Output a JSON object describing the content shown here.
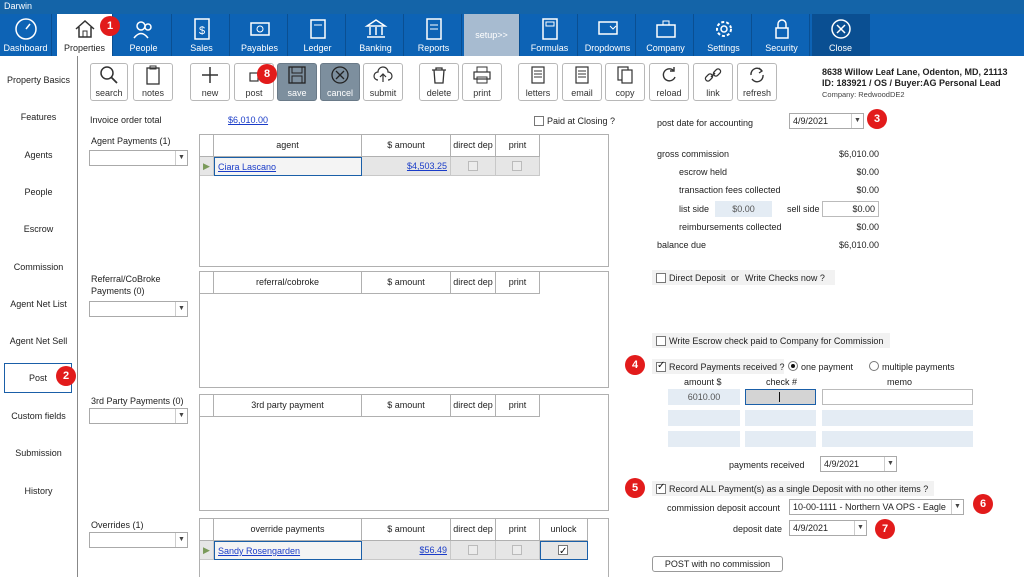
{
  "window": {
    "title": "Darwin"
  },
  "nav": {
    "items": [
      {
        "label": "Dashboard",
        "icon": "dashboard-icon"
      },
      {
        "label": "Properties",
        "icon": "house-icon"
      },
      {
        "label": "People",
        "icon": "people-icon"
      },
      {
        "label": "Sales",
        "icon": "dollar-doc-icon"
      },
      {
        "label": "Payables",
        "icon": "money-icon"
      },
      {
        "label": "Ledger",
        "icon": "ledger-icon"
      },
      {
        "label": "Banking",
        "icon": "bank-icon"
      },
      {
        "label": "Reports",
        "icon": "report-icon"
      },
      {
        "label": "setup>>",
        "icon": ""
      },
      {
        "label": "Formulas",
        "icon": "calculator-icon"
      },
      {
        "label": "Dropdowns",
        "icon": "dropdown-icon"
      },
      {
        "label": "Company",
        "icon": "briefcase-icon"
      },
      {
        "label": "Settings",
        "icon": "gear-icon"
      },
      {
        "label": "Security",
        "icon": "lock-icon"
      },
      {
        "label": "Close",
        "icon": "close-icon"
      }
    ]
  },
  "badges": [
    "1",
    "2",
    "3",
    "4",
    "5",
    "6",
    "7",
    "8"
  ],
  "sidebar": {
    "items": [
      {
        "label": "Property Basics"
      },
      {
        "label": "Features"
      },
      {
        "label": "Agents"
      },
      {
        "label": "People"
      },
      {
        "label": "Escrow"
      },
      {
        "label": "Commission"
      },
      {
        "label": "Agent Net List"
      },
      {
        "label": "Agent Net Sell"
      },
      {
        "label": "Post"
      },
      {
        "label": "Custom fields"
      },
      {
        "label": "Submission"
      },
      {
        "label": "History"
      }
    ]
  },
  "toolbar": {
    "buttons": [
      {
        "label": "search"
      },
      {
        "label": "notes"
      },
      {
        "label": "new"
      },
      {
        "label": "post"
      },
      {
        "label": "save"
      },
      {
        "label": "cancel"
      },
      {
        "label": "submit"
      },
      {
        "label": "delete"
      },
      {
        "label": "print"
      },
      {
        "label": "letters"
      },
      {
        "label": "email"
      },
      {
        "label": "copy"
      },
      {
        "label": "reload"
      },
      {
        "label": "link"
      },
      {
        "label": "refresh"
      }
    ]
  },
  "property": {
    "address": "8638 Willow Leaf Lane, Odenton, MD, 21113",
    "id_line": "ID: 183921 / OS / Buyer:AG Personal Lead",
    "company": "Company: RedwoodDE2"
  },
  "invoice": {
    "label": "Invoice order total",
    "amount": "$6,010.00",
    "paid_closing": "Paid at Closing ?"
  },
  "agent_payments": {
    "label": "Agent Payments (1)",
    "headers": [
      "agent",
      "$ amount",
      "direct dep",
      "print"
    ],
    "rows": [
      {
        "agent": "Ciara Lascano",
        "amount": "$4,503.25"
      }
    ]
  },
  "referral_payments": {
    "label": "Referral/CoBroke Payments (0)",
    "headers": [
      "referral/cobroke",
      "$ amount",
      "direct dep",
      "print"
    ]
  },
  "third_party_payments": {
    "label": "3rd Party Payments (0)",
    "headers": [
      "3rd party payment",
      "$ amount",
      "direct dep",
      "print"
    ]
  },
  "overrides": {
    "label": "Overrides (1)",
    "headers": [
      "override payments",
      "$ amount",
      "direct dep",
      "print",
      "unlock"
    ],
    "rows": [
      {
        "name": "Sandy Rosengarden",
        "amount": "$56.49"
      }
    ]
  },
  "accounting": {
    "post_date_label": "post date for accounting",
    "post_date": "4/9/2021",
    "gross_commission_label": "gross commission",
    "gross_commission": "$6,010.00",
    "escrow_held_label": "escrow held",
    "escrow_held": "$0.00",
    "transaction_fees_label": "transaction fees collected",
    "transaction_fees": "$0.00",
    "list_side_label": "list side",
    "list_side": "$0.00",
    "sell_side_label": "sell side",
    "sell_side": "$0.00",
    "reimbursements_label": "reimbursements collected",
    "reimbursements": "$0.00",
    "balance_due_label": "balance due",
    "balance_due": "$6,010.00",
    "direct_deposit_label": "Direct Deposit",
    "or_label": "or",
    "write_checks_label": "Write Checks now ?",
    "write_escrow_label": "Write Escrow check paid to Company for Commission"
  },
  "record_payments": {
    "label": "Record Payments received ?",
    "one_payment": "one payment",
    "multiple_payments": "multiple payments",
    "amount_header": "amount $",
    "check_header": "check #",
    "memo_header": "memo",
    "amount": "6010.00",
    "received_label": "payments received",
    "received_date": "4/9/2021"
  },
  "deposit": {
    "record_all_label": "Record ALL Payment(s) as a single Deposit with no other items ?",
    "account_label": "commission deposit account",
    "account": "10-00-1111 - Northern VA OPS - Eagle",
    "date_label": "deposit date",
    "date": "4/9/2021"
  },
  "post_no_commission": "POST with no commission"
}
